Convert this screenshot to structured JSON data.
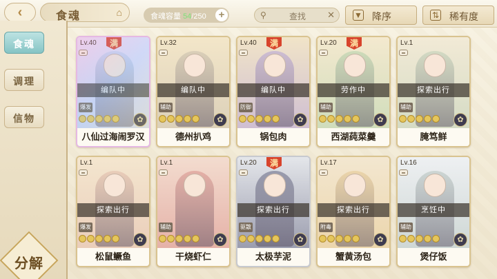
{
  "header": {
    "title": "食魂",
    "capacity_label": "食魂容量",
    "capacity_current": "54",
    "capacity_total": "/250",
    "search_placeholder": "查找",
    "sort_order_label": "降序",
    "sort_key_label": "稀有度"
  },
  "sidebar": {
    "tabs": [
      {
        "label": "食魂"
      },
      {
        "label": "调理"
      },
      {
        "label": "信物"
      }
    ],
    "decompose_label": "分解"
  },
  "cards": [
    {
      "level": "Lv.40",
      "full": "满",
      "status": "编队中",
      "role": "爆发",
      "name": "八仙过海闹罗汉",
      "stars": 5,
      "colors": [
        "#e8e0f5",
        "#c9d3ef"
      ]
    },
    {
      "level": "Lv.32",
      "full": "",
      "status": "编队中",
      "role": "辅助",
      "name": "德州扒鸡",
      "stars": 5,
      "colors": [
        "#f3e6c9",
        "#d7ccb6"
      ]
    },
    {
      "level": "Lv.40",
      "full": "满",
      "status": "编队中",
      "role": "防御",
      "name": "锅包肉",
      "stars": 5,
      "colors": [
        "#f1e4c8",
        "#c8b7d4"
      ]
    },
    {
      "level": "Lv.20",
      "full": "满",
      "status": "劳作中",
      "role": "辅助",
      "name": "西湖莼菜羹",
      "stars": 5,
      "colors": [
        "#f4e9cf",
        "#c8dab7"
      ]
    },
    {
      "level": "Lv.1",
      "full": "",
      "status": "探索出行",
      "role": "辅助",
      "name": "腌笃鲜",
      "stars": 5,
      "colors": [
        "#f2ead6",
        "#cfd8c1"
      ]
    },
    {
      "level": "Lv.1",
      "full": "",
      "status": "探索出行",
      "role": "爆发",
      "name": "松鼠鳜鱼",
      "stars": 5,
      "colors": [
        "#f4e6cf",
        "#e8c9b6"
      ]
    },
    {
      "level": "Lv.1",
      "full": "",
      "status": "",
      "role": "辅助",
      "name": "干烧虾仁",
      "stars": 5,
      "colors": [
        "#f3dccf",
        "#e2a9a0"
      ]
    },
    {
      "level": "Lv.20",
      "full": "满",
      "status": "探索出行",
      "role": "驱散",
      "name": "太极芋泥",
      "stars": 5,
      "colors": [
        "#e4e6ea",
        "#8d8fa3"
      ]
    },
    {
      "level": "Lv.17",
      "full": "",
      "status": "探索出行",
      "role": "附毒",
      "name": "蟹黄汤包",
      "stars": 5,
      "colors": [
        "#f3e7d0",
        "#ead2a5"
      ]
    },
    {
      "level": "Lv.16",
      "full": "",
      "status": "烹饪中",
      "role": "辅助",
      "name": "煲仔饭",
      "stars": 5,
      "colors": [
        "#eef0f2",
        "#c8d2cf"
      ]
    }
  ]
}
